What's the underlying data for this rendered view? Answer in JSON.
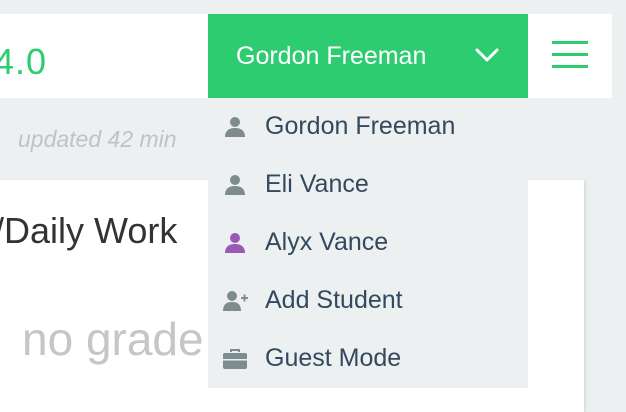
{
  "header": {
    "gpa": "4.0",
    "user_name": "Gordon Freeman",
    "icons": {
      "user_chevron": "chevron-down-icon",
      "menu": "hamburger-menu-icon"
    }
  },
  "status": {
    "updated_text": "updated 42 min"
  },
  "card": {
    "title": "/Daily Work",
    "empty_text": "no grade"
  },
  "dropdown": {
    "items": [
      {
        "label": "Gordon Freeman",
        "icon": "user-icon",
        "icon_color": "#7f8c8d"
      },
      {
        "label": "Eli Vance",
        "icon": "user-icon",
        "icon_color": "#7f8c8d"
      },
      {
        "label": "Alyx Vance",
        "icon": "user-icon",
        "icon_color": "#9b59b6"
      },
      {
        "label": "Add Student",
        "icon": "add-user-icon",
        "icon_color": "#7f8c8d"
      },
      {
        "label": "Guest Mode",
        "icon": "briefcase-icon",
        "icon_color": "#7f8c8d"
      }
    ]
  },
  "colors": {
    "accent": "#2ecc71",
    "background": "#ecf0f1",
    "text": "#34495e",
    "muted": "#bdc3c7"
  }
}
